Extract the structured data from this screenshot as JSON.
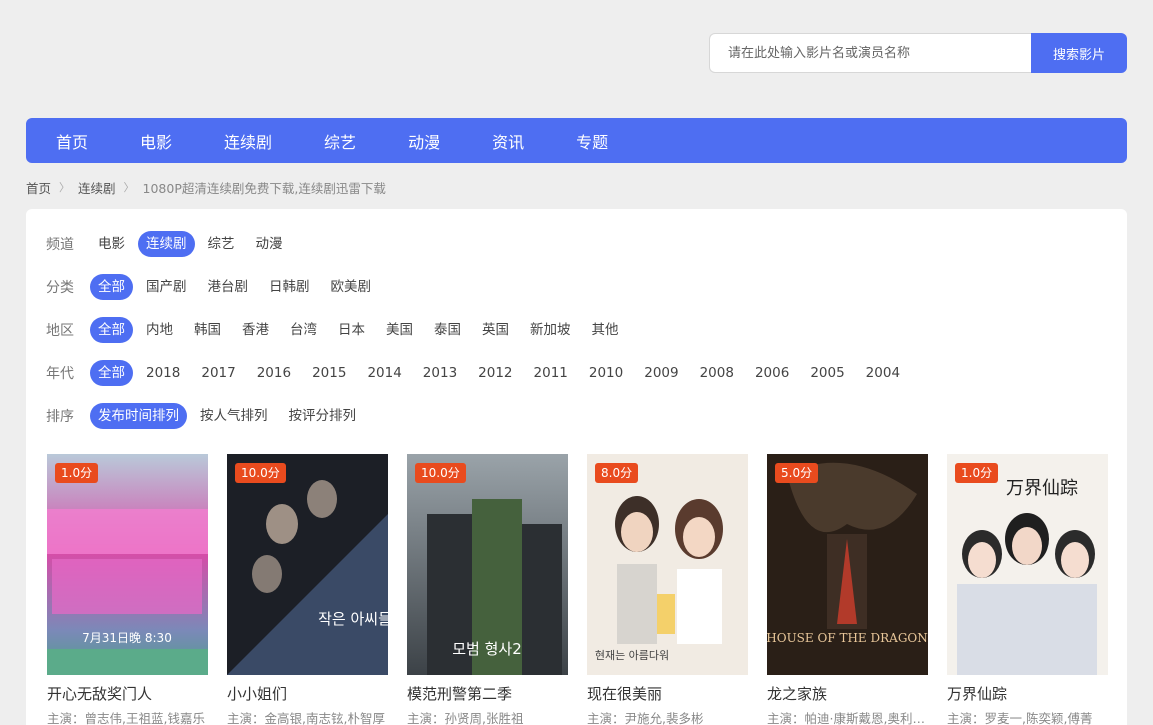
{
  "search": {
    "placeholder": "请在此处输入影片名或演员名称",
    "button_label": "搜索影片"
  },
  "nav": {
    "items": [
      "首页",
      "电影",
      "连续剧",
      "综艺",
      "动漫",
      "资讯",
      "专题"
    ]
  },
  "breadcrumb": {
    "home": "首页",
    "section": "连续剧",
    "current": "1080P超清连续剧免费下载,连续剧迅雷下载"
  },
  "filters": {
    "channel": {
      "label": "频道",
      "options": [
        "电影",
        "连续剧",
        "综艺",
        "动漫"
      ],
      "active": "连续剧"
    },
    "category": {
      "label": "分类",
      "options": [
        "全部",
        "国产剧",
        "港台剧",
        "日韩剧",
        "欧美剧"
      ],
      "active": "全部"
    },
    "region": {
      "label": "地区",
      "options": [
        "全部",
        "内地",
        "韩国",
        "香港",
        "台湾",
        "日本",
        "美国",
        "泰国",
        "英国",
        "新加坡",
        "其他"
      ],
      "active": "全部"
    },
    "year": {
      "label": "年代",
      "options": [
        "全部",
        "2018",
        "2017",
        "2016",
        "2015",
        "2014",
        "2013",
        "2012",
        "2011",
        "2010",
        "2009",
        "2008",
        "2006",
        "2005",
        "2004"
      ],
      "active": "全部"
    },
    "sort": {
      "label": "排序",
      "options": [
        "发布时间排列",
        "按人气排列",
        "按评分排列"
      ],
      "active": "发布时间排列"
    }
  },
  "movies": [
    {
      "title": "开心无敌奖门人",
      "cast": "主演：曾志伟,王祖蓝,钱嘉乐",
      "score": "1.0分",
      "poster_text": "7月31日晚 8:30"
    },
    {
      "title": "小小姐们",
      "cast": "主演：金高银,南志铉,朴智厚",
      "score": "10.0分",
      "poster_text": "작은 아씨들"
    },
    {
      "title": "模范刑警第二季",
      "cast": "主演：孙贤周,张胜祖",
      "score": "10.0分",
      "poster_text": "모범 형사2"
    },
    {
      "title": "现在很美丽",
      "cast": "主演：尹施允,裴多彬",
      "score": "8.0分",
      "poster_text": "현재는 아름다워"
    },
    {
      "title": "龙之家族",
      "cast": "主演：帕迪·康斯戴恩,奥利维亚",
      "score": "5.0分",
      "poster_text": "HOUSE OF THE DRAGON"
    },
    {
      "title": "万界仙踪",
      "cast": "主演：罗麦一,陈奕颖,傅菁",
      "score": "1.0分",
      "poster_text": "万界仙踪"
    }
  ],
  "colors": {
    "accent": "#4e6ef2",
    "score_badge": "#e94b1e",
    "page_bg": "#eeeeee"
  }
}
